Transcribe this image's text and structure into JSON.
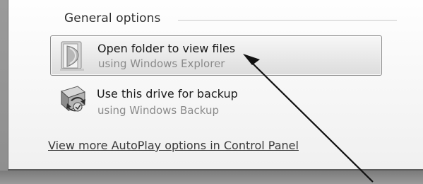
{
  "group": {
    "heading": "General options"
  },
  "options": [
    {
      "title": "Open folder to view files",
      "subtitle": "using Windows Explorer",
      "icon": "folder-icon",
      "selected": true
    },
    {
      "title": "Use this drive for backup",
      "subtitle": "using Windows Backup",
      "icon": "backup-icon",
      "selected": false
    }
  ],
  "footer": {
    "link": "View more AutoPlay options in Control Panel"
  },
  "colors": {
    "selected_bg": "#e8e8e8",
    "link_text": "#3a3a3a",
    "subtitle_text": "#8a8a8a"
  }
}
